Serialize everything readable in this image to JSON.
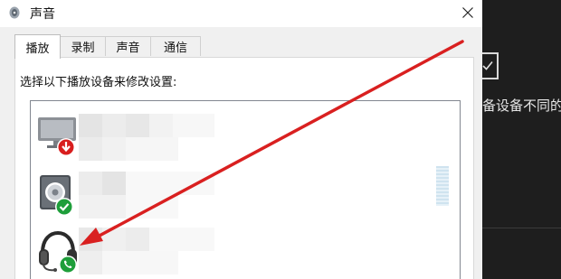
{
  "window": {
    "title": "声音"
  },
  "tabs": [
    {
      "label": "播放",
      "active": true
    },
    {
      "label": "录制",
      "active": false
    },
    {
      "label": "声音",
      "active": false
    },
    {
      "label": "通信",
      "active": false
    }
  ],
  "playback": {
    "instruction": "选择以下播放设备来修改设置:"
  },
  "devices": [
    {
      "icon": "monitor-speaker-icon",
      "status_badge": "down-arrow-red"
    },
    {
      "icon": "speaker-icon",
      "status_badge": "check-green"
    },
    {
      "icon": "headset-icon",
      "status_badge": "phone-green"
    }
  ],
  "background": {
    "partial_text": "备设备不同的声"
  },
  "colors": {
    "annotation_arrow": "#d92020",
    "ok_badge": "#1e9e3a",
    "error_badge": "#d81e1e"
  }
}
